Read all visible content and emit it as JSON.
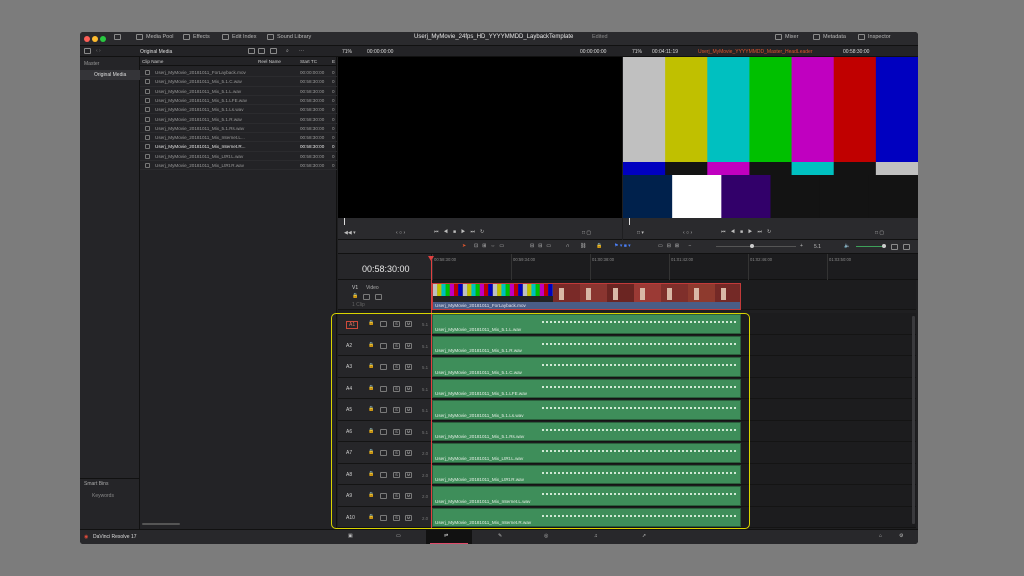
{
  "titlebar": {
    "media_pool": "Media Pool",
    "effects": "Effects",
    "edit_index": "Edit Index",
    "sound_library": "Sound Library",
    "project_title": "Userj_MyMovie_24fps_HD_YYYYMMDD_LaybackTemplate",
    "status": "Edited",
    "mixer": "Mixer",
    "metadata": "Metadata",
    "inspector": "Inspector"
  },
  "media_pool": {
    "bin_title": "Original Media",
    "col_clip": "Clip Name",
    "col_reel": "Reel Name",
    "col_start": "Start TC",
    "col_x": "E",
    "rows": [
      {
        "name": "Userj_MyMovie_20181011_ForLayback.mov",
        "tc": "00:00:00:00",
        "e": "0"
      },
      {
        "name": "Userj_MyMovie_20181011_Mix_5.1.C.wav",
        "tc": "00:58:30:00",
        "e": "0"
      },
      {
        "name": "Userj_MyMovie_20181011_Mix_5.1.L.wav",
        "tc": "00:58:30:00",
        "e": "0"
      },
      {
        "name": "Userj_MyMovie_20181011_Mix_5.1.LFE.wav",
        "tc": "00:58:30:00",
        "e": "0"
      },
      {
        "name": "Userj_MyMovie_20181011_Mix_5.1.Ls.wav",
        "tc": "00:58:30:00",
        "e": "0"
      },
      {
        "name": "Userj_MyMovie_20181011_Mix_5.1.R.wav",
        "tc": "00:58:30:00",
        "e": "0"
      },
      {
        "name": "Userj_MyMovie_20181011_Mix_5.1.Rs.wav",
        "tc": "00:58:30:00",
        "e": "0"
      },
      {
        "name": "Userj_MyMovie_20181011_Mix_Internet.L...",
        "tc": "00:58:30:00",
        "e": "0"
      },
      {
        "name": "Userj_MyMovie_20181011_Mix_Internet.R...",
        "tc": "00:58:30:00",
        "e": "0"
      },
      {
        "name": "Userj_MyMovie_20181011_Mix_LtRt.L.wav",
        "tc": "00:58:30:00",
        "e": "0"
      },
      {
        "name": "Userj_MyMovie_20181011_Mix_LtRt.R.wav",
        "tc": "00:58:30:00",
        "e": "0"
      }
    ]
  },
  "sidebar": {
    "master": "Master",
    "original_media": "Original Media",
    "smart_bins": "Smart Bins",
    "keywords": "Keywords"
  },
  "source_viewer": {
    "zoom": "71%",
    "timecode": "00:00:00:00",
    "right_tc": "00:00:00:00"
  },
  "timeline_viewer": {
    "zoom": "71%",
    "duration": "00:04:11:19",
    "timeline_name": "Userj_MyMovie_YYYYMMDD_Master_HeadLeader",
    "timecode": "00:58:30:00"
  },
  "timeline": {
    "current_tc": "00:58:30:00",
    "ruler": [
      "00:58:30:00",
      "00:59:34:00",
      "01:00:38:00",
      "01:01:42:00",
      "01:02:46:00",
      "01:03:50:00"
    ],
    "audio_format": "5.1",
    "v1": {
      "id": "V1",
      "label": "Video",
      "clip": "Userj_MyMovie_20181011_ForLayback.mov",
      "sub": "1 Clip"
    },
    "audio_tracks": [
      {
        "id": "A1",
        "fmt": "5.1",
        "clip": "Userj_MyMovie_20181011_Mix_5.1.L.wav"
      },
      {
        "id": "A2",
        "fmt": "5.1",
        "clip": "Userj_MyMovie_20181011_Mix_5.1.R.wav"
      },
      {
        "id": "A3",
        "fmt": "5.1",
        "clip": "Userj_MyMovie_20181011_Mix_5.1.C.wav"
      },
      {
        "id": "A4",
        "fmt": "5.1",
        "clip": "Userj_MyMovie_20181011_Mix_5.1.LFE.wav"
      },
      {
        "id": "A5",
        "fmt": "5.1",
        "clip": "Userj_MyMovie_20181011_Mix_5.1.Ls.wav"
      },
      {
        "id": "A6",
        "fmt": "5.1",
        "clip": "Userj_MyMovie_20181011_Mix_5.1.Rs.wav"
      },
      {
        "id": "A7",
        "fmt": "2.0",
        "clip": "Userj_MyMovie_20181011_Mix_LtRt.L.wav"
      },
      {
        "id": "A8",
        "fmt": "2.0",
        "clip": "Userj_MyMovie_20181011_Mix_LtRt.R.wav"
      },
      {
        "id": "A9",
        "fmt": "2.0",
        "clip": "Userj_MyMovie_20181011_Mix_Internet.L.wav"
      },
      {
        "id": "A10",
        "fmt": "2.0",
        "clip": "Userj_MyMovie_20181011_Mix_Internet.R.wav"
      }
    ],
    "s": "S",
    "m": "M"
  },
  "bottom": {
    "app_name": "DaVinci Resolve 17"
  },
  "colors": {
    "playhead": "#e04040",
    "clip_green": "#3e8e5a",
    "highlight": "#d9d400",
    "timeline_name": "#e0562e"
  }
}
